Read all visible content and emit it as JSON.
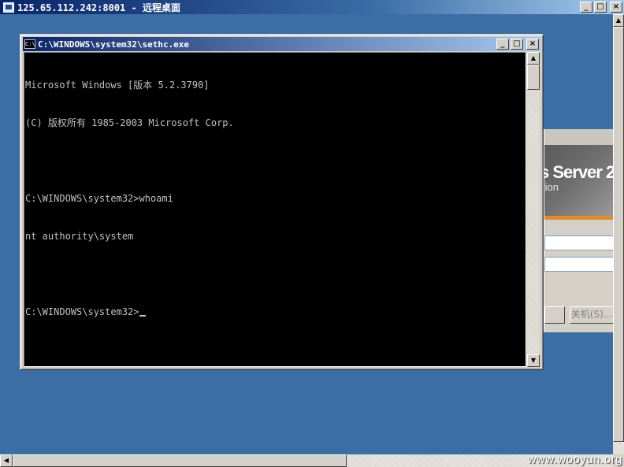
{
  "rdp_window": {
    "title": "125.65.112.242:8001 - 远程桌面",
    "minimize": "_",
    "maximize": "□",
    "close": "×"
  },
  "cmd_window": {
    "icon_text": "C:\\",
    "title": "C:\\WINDOWS\\system32\\sethc.exe",
    "minimize": "_",
    "maximize": "□",
    "close": "×",
    "lines": [
      "Microsoft Windows [版本 5.2.3790]",
      "(C) 版权所有 1985-2003 Microsoft Corp.",
      "",
      "C:\\WINDOWS\\system32>whoami",
      "nt authority\\system",
      "",
      "C:\\WINDOWS\\system32>"
    ]
  },
  "login_dialog": {
    "product_name": "s Server 2",
    "product_edition": "tion",
    "shutdown_button": "关机(S)..."
  },
  "scroll": {
    "up_arrow": "▲",
    "down_arrow": "▼",
    "left_arrow": "◀",
    "right_arrow": "▶"
  },
  "watermark": "www.wooyun.org",
  "colors": {
    "desktop_bg": "#3a6ea5",
    "console_bg": "#000000",
    "console_fg": "#c0c0c0",
    "titlebar_active": "#0a246a",
    "accent_orange": "#e38b2c"
  }
}
